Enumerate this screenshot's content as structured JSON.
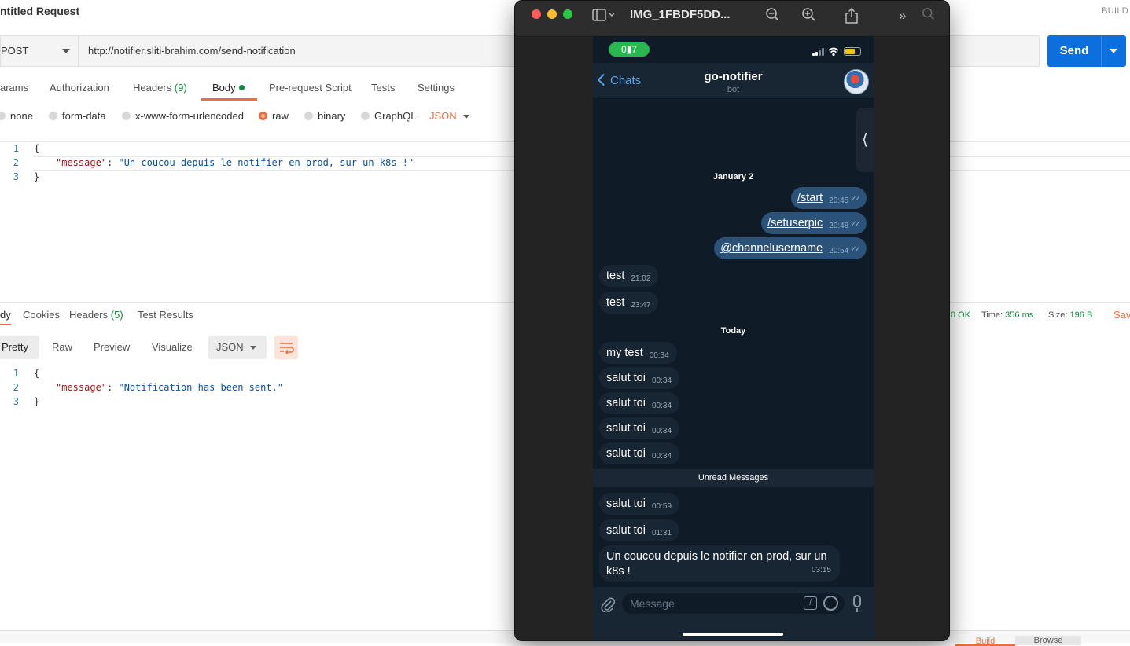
{
  "postman": {
    "title": "ntitled Request",
    "build": "BUILD",
    "method": "POST",
    "url": "http://notifier.sliti-brahim.com/send-notification",
    "send_label": "Send",
    "req_tabs": {
      "params": "arams",
      "authorization": "Authorization",
      "headers": "Headers",
      "headers_count": "(9)",
      "body": "Body",
      "prerequest": "Pre-request Script",
      "tests": "Tests",
      "settings": "Settings"
    },
    "body_types": {
      "none": "none",
      "form_data": "form-data",
      "urlencoded": "x-www-form-urlencoded",
      "raw": "raw",
      "binary": "binary",
      "graphql": "GraphQL",
      "lang": "JSON"
    },
    "request_body": {
      "line_numbers": [
        "1",
        "2",
        "3"
      ],
      "open": "{",
      "key": "\"message\"",
      "colon": ": ",
      "value": "\"Un coucou depuis le notifier en prod, sur un k8s !\"",
      "close": "}"
    },
    "res_tabs": {
      "body": "dy",
      "cookies": "Cookies",
      "headers": "Headers",
      "headers_count": "(5)",
      "test_results": "Test Results"
    },
    "res_status": {
      "status": "0 OK",
      "time_label": "Time:",
      "time": "356 ms",
      "size_label": "Size:",
      "size": "196 B",
      "save": "Sav"
    },
    "view_bar": {
      "pretty": "Pretty",
      "raw": "Raw",
      "preview": "Preview",
      "visualize": "Visualize",
      "format": "JSON"
    },
    "response_body": {
      "line_numbers": [
        "1",
        "2",
        "3"
      ],
      "open": "{",
      "key": "\"message\"",
      "colon": ": ",
      "value": "\"Notification has been sent.\"",
      "close": "}"
    },
    "footer": {
      "build": "Build",
      "browse": "Browse"
    }
  },
  "viewer": {
    "title": "IMG_1FBDF5DD...",
    "colors": {
      "close": "#ff5f57",
      "minimize": "#febc2e",
      "zoom": "#28c840"
    }
  },
  "telegram": {
    "status_pill": "0▮7",
    "back_label": "Chats",
    "chat_name": "go-notifier",
    "chat_sub": "bot",
    "dates": {
      "first": "January 2",
      "second": "Today"
    },
    "unread_label": "Unread Messages",
    "outgoing": [
      {
        "text": "/start",
        "time": "20:45"
      },
      {
        "text": "/setuserpic",
        "time": "20:48"
      },
      {
        "text": "@channelusername",
        "time": "20:54"
      }
    ],
    "incoming_jan": [
      {
        "text": "test",
        "time": "21:02"
      },
      {
        "text": "test",
        "time": "23:47"
      }
    ],
    "incoming_today": [
      {
        "text": "my test",
        "time": "00:34"
      },
      {
        "text": "salut toi",
        "time": "00:34"
      },
      {
        "text": "salut toi",
        "time": "00:34"
      },
      {
        "text": "salut toi",
        "time": "00:34"
      },
      {
        "text": "salut toi",
        "time": "00:34"
      }
    ],
    "incoming_unread": [
      {
        "text": "salut toi",
        "time": "00:59"
      },
      {
        "text": "salut toi",
        "time": "01:31"
      }
    ],
    "last_message": {
      "text": "Un coucou depuis le notifier en prod, sur un k8s !",
      "time": "03:15"
    },
    "input_placeholder": "Message",
    "accent": "#5aa7e6"
  }
}
